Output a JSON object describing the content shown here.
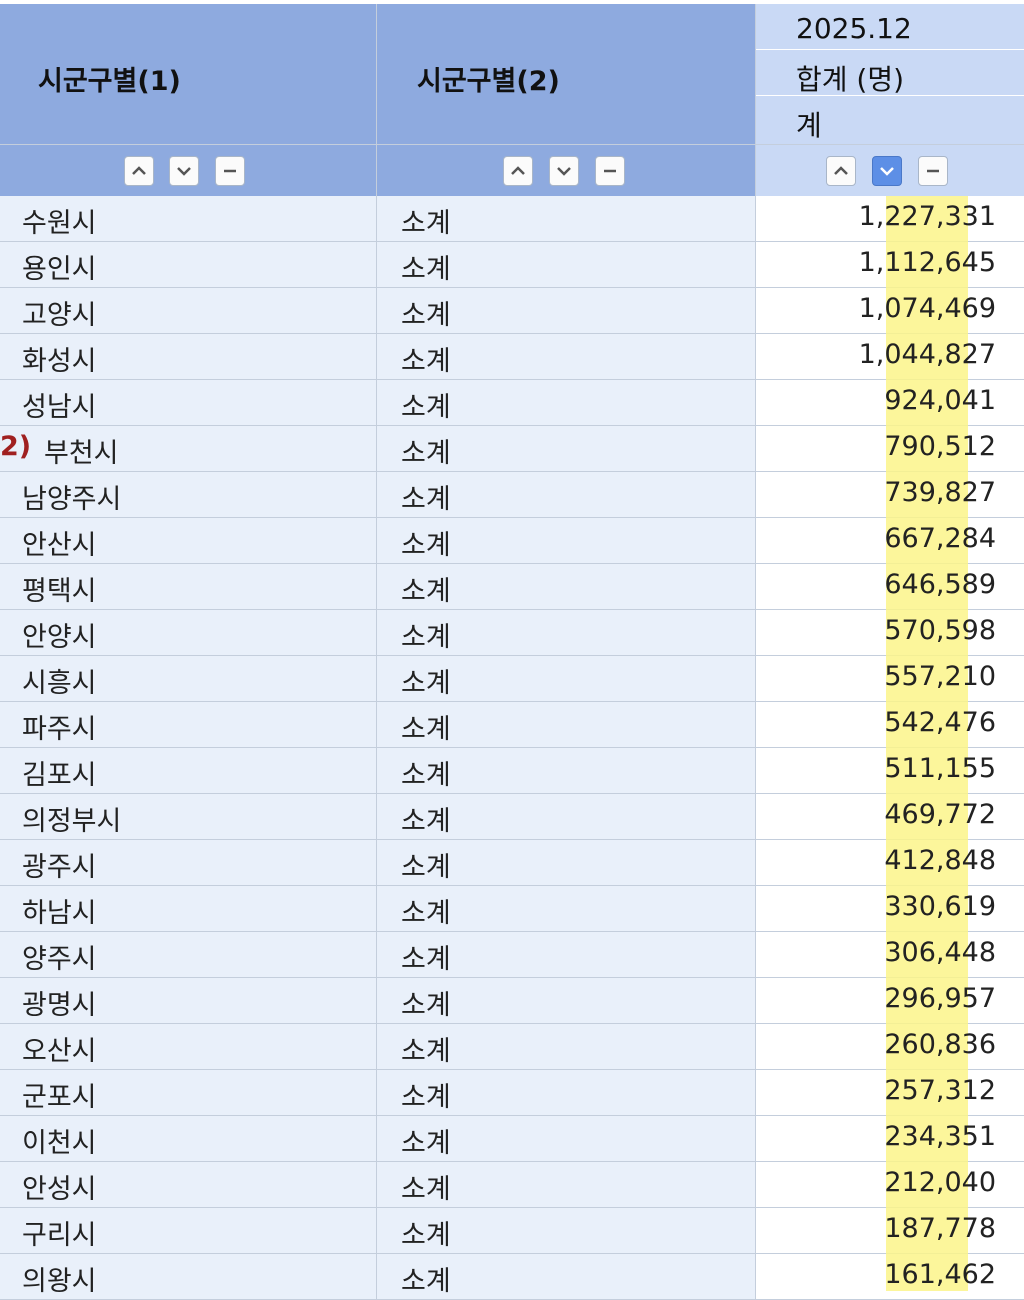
{
  "header": {
    "col1_title": "시군구별(1)",
    "col2_title": "시군구별(2)",
    "period": "2025.12",
    "measure": "합계 (명)",
    "sub": "계"
  },
  "icons": {
    "sort_up": "chevron-up-icon",
    "sort_down": "chevron-down-icon",
    "collapse": "minus-icon"
  },
  "colors": {
    "header_bg": "#8eaadf",
    "header_light_bg": "#c9d9f5",
    "row_bg": "#e9f0fa",
    "highlight": "#fbf58a",
    "active_sort": "#5d8fe6",
    "marker": "#a02020"
  },
  "marker_label": "2)",
  "rows": [
    {
      "city": "수원시",
      "sub": "소계",
      "value": "1,227,331"
    },
    {
      "city": "용인시",
      "sub": "소계",
      "value": "1,112,645"
    },
    {
      "city": "고양시",
      "sub": "소계",
      "value": "1,074,469"
    },
    {
      "city": "화성시",
      "sub": "소계",
      "value": "1,044,827"
    },
    {
      "city": "성남시",
      "sub": "소계",
      "value": "924,041"
    },
    {
      "city": "부천시",
      "sub": "소계",
      "value": "790,512"
    },
    {
      "city": "남양주시",
      "sub": "소계",
      "value": "739,827"
    },
    {
      "city": "안산시",
      "sub": "소계",
      "value": "667,284"
    },
    {
      "city": "평택시",
      "sub": "소계",
      "value": "646,589"
    },
    {
      "city": "안양시",
      "sub": "소계",
      "value": "570,598"
    },
    {
      "city": "시흥시",
      "sub": "소계",
      "value": "557,210"
    },
    {
      "city": "파주시",
      "sub": "소계",
      "value": "542,476"
    },
    {
      "city": "김포시",
      "sub": "소계",
      "value": "511,155"
    },
    {
      "city": "의정부시",
      "sub": "소계",
      "value": "469,772"
    },
    {
      "city": "광주시",
      "sub": "소계",
      "value": "412,848"
    },
    {
      "city": "하남시",
      "sub": "소계",
      "value": "330,619"
    },
    {
      "city": "양주시",
      "sub": "소계",
      "value": "306,448"
    },
    {
      "city": "광명시",
      "sub": "소계",
      "value": "296,957"
    },
    {
      "city": "오산시",
      "sub": "소계",
      "value": "260,836"
    },
    {
      "city": "군포시",
      "sub": "소계",
      "value": "257,312"
    },
    {
      "city": "이천시",
      "sub": "소계",
      "value": "234,351"
    },
    {
      "city": "안성시",
      "sub": "소계",
      "value": "212,040"
    },
    {
      "city": "구리시",
      "sub": "소계",
      "value": "187,778"
    },
    {
      "city": "의왕시",
      "sub": "소계",
      "value": "161,462"
    }
  ]
}
